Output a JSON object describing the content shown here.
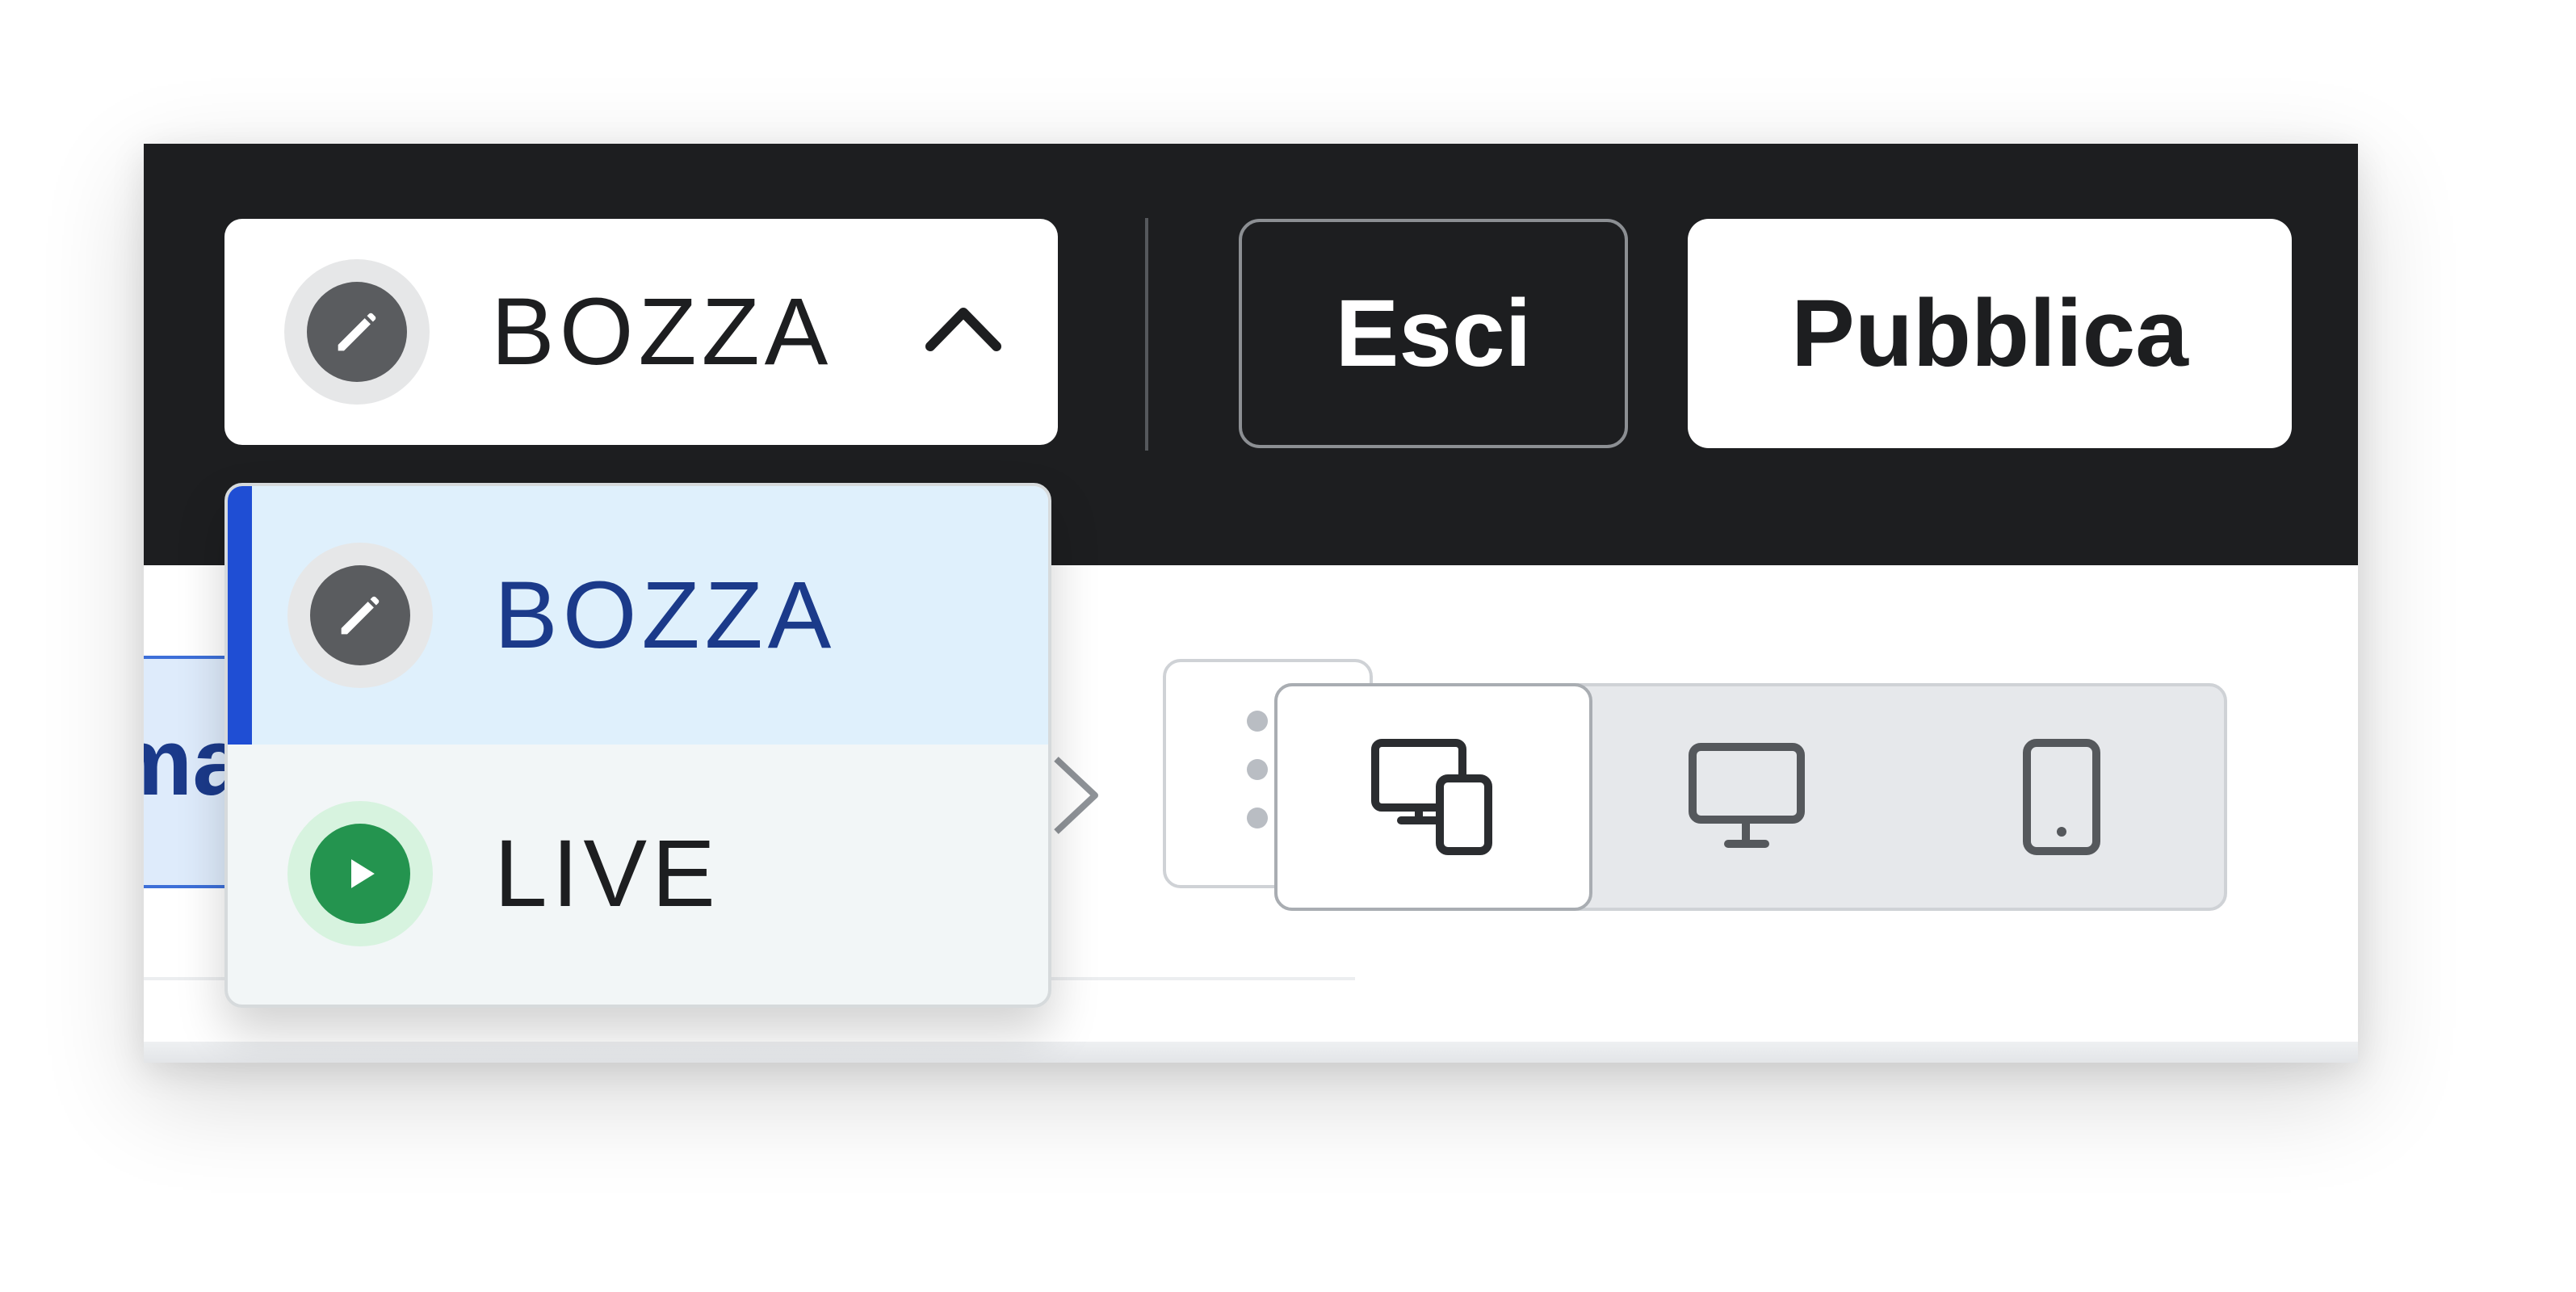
{
  "status_selector": {
    "current_label": "BOZZA",
    "icon": "pencil-icon",
    "expanded": true
  },
  "toolbar": {
    "exit_label": "Esci",
    "publish_label": "Pubblica"
  },
  "status_menu": {
    "items": [
      {
        "label": "BOZZA",
        "icon": "pencil-icon",
        "selected": true,
        "color": "#5a5c5f"
      },
      {
        "label": "LIVE",
        "icon": "play-icon",
        "selected": false,
        "color": "#24944f"
      }
    ]
  },
  "content": {
    "field_fragment": "ma"
  },
  "device_preview": {
    "options": [
      {
        "icon": "responsive-devices-icon",
        "selected": true
      },
      {
        "icon": "desktop-icon",
        "selected": false
      },
      {
        "icon": "mobile-icon",
        "selected": false
      }
    ]
  },
  "colors": {
    "topbar": "#1d1e20",
    "accent": "#1f4ed4",
    "selected_bg": "#dff0fc",
    "live_green": "#24944f"
  }
}
